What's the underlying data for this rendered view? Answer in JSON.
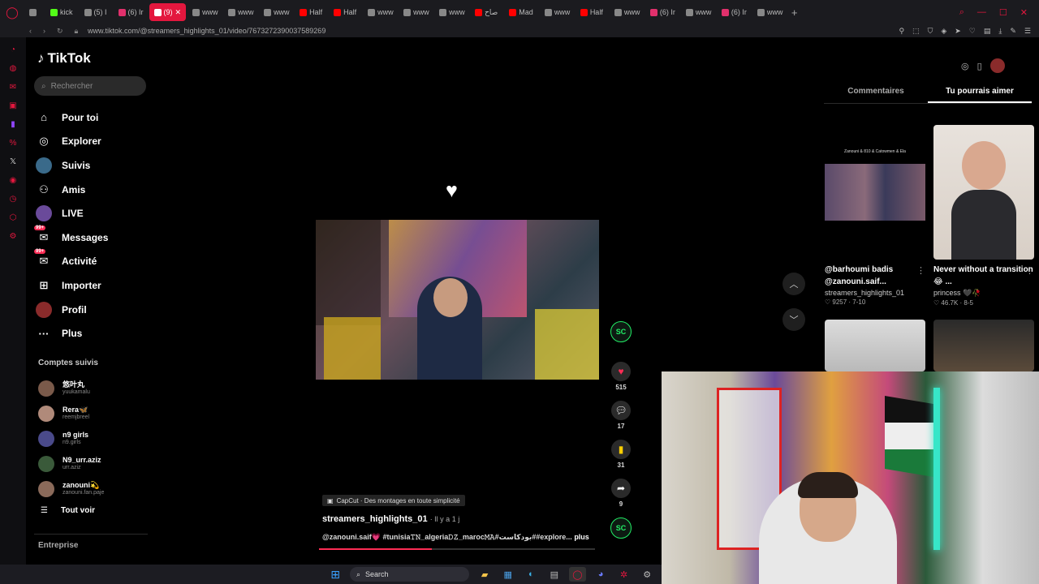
{
  "browser": {
    "tabs": [
      {
        "label": "",
        "color": "#888"
      },
      {
        "label": "kick",
        "color": "#53fc18"
      },
      {
        "label": "(5) I",
        "color": "#888"
      },
      {
        "label": "(6) Ir",
        "color": "#e1306c"
      },
      {
        "label": "(9)",
        "color": "#ffffff",
        "active": true
      },
      {
        "label": "www",
        "color": "#888"
      },
      {
        "label": "www",
        "color": "#888"
      },
      {
        "label": "www",
        "color": "#888"
      },
      {
        "label": "Half",
        "color": "#ff0000"
      },
      {
        "label": "Half",
        "color": "#ff0000"
      },
      {
        "label": "www",
        "color": "#888"
      },
      {
        "label": "www",
        "color": "#888"
      },
      {
        "label": "www",
        "color": "#888"
      },
      {
        "label": "صاح",
        "color": "#ff0000"
      },
      {
        "label": "Mad",
        "color": "#ff0000"
      },
      {
        "label": "www",
        "color": "#888"
      },
      {
        "label": "Half",
        "color": "#ff0000"
      },
      {
        "label": "www",
        "color": "#888"
      },
      {
        "label": "(6) Ir",
        "color": "#e1306c"
      },
      {
        "label": "www",
        "color": "#888"
      },
      {
        "label": "(6) Ir",
        "color": "#e1306c"
      },
      {
        "label": "www",
        "color": "#888"
      }
    ],
    "url": "www.tiktok.com/@streamers_highlights_01/video/7673272390037589269",
    "accent": "#e3173e"
  },
  "tiktok": {
    "logo_text": "TikTok",
    "search_placeholder": "Rechercher",
    "nav": [
      {
        "label": "Pour toi",
        "icon": "home-icon"
      },
      {
        "label": "Explorer",
        "icon": "compass-icon"
      },
      {
        "label": "Suivis",
        "icon": "following-avatar"
      },
      {
        "label": "Amis",
        "icon": "friends-icon"
      },
      {
        "label": "LIVE",
        "icon": "live-avatar"
      },
      {
        "label": "Messages",
        "icon": "message-icon",
        "badge": "99+"
      },
      {
        "label": "Activité",
        "icon": "activity-icon",
        "badge": "99+"
      },
      {
        "label": "Importer",
        "icon": "upload-icon"
      },
      {
        "label": "Profil",
        "icon": "profile-avatar"
      },
      {
        "label": "Plus",
        "icon": "more-icon"
      }
    ],
    "following_title": "Comptes suivis",
    "following": [
      {
        "name": "悠叶丸",
        "handle": "yuukamalu",
        "color": "#7a5a4a"
      },
      {
        "name": "Rera🦋",
        "handle": "reemjbreel",
        "color": "#b08a7a"
      },
      {
        "name": "n9 girls",
        "handle": "n9.girls",
        "color": "#4a4a8a"
      },
      {
        "name": "N9_urr.aziz",
        "handle": "urr.aziz",
        "color": "#3a5a3a"
      },
      {
        "name": "zanouni💫",
        "handle": "zanouni.fan.paje",
        "color": "#8a6a5a"
      }
    ],
    "see_all": "Tout voir",
    "entreprise": "Entreprise"
  },
  "video": {
    "author": "streamers_highlights_01",
    "time": "· Il y a 1 j",
    "description": "@zanouni.saif💗 #tunisia𝚃𝙽_algeria𝙳𝚉_maroc𝙼𝙰#بودكاست##explore...",
    "more": "plus",
    "capcut": "CapCut · Des montages en toute simplicité",
    "creator_initials": "SC",
    "likes": "515",
    "comments": "17",
    "saves": "31",
    "shares": "9",
    "progress": 0.41
  },
  "right_panel": {
    "tabs": [
      "Commentaires",
      "Tu pourrais aimer"
    ],
    "active_tab": 1,
    "cards": [
      {
        "title": "@barhoumi badis @zanouni.saif...",
        "author": "streamers_highlights_01",
        "stats": "♡ 9257 · 7-10",
        "caption": "Zanouni & 810 & Catowmen & Ela"
      },
      {
        "title": "Never without a transition 😂 ...",
        "author": "princess 🖤🥀",
        "stats": "♡ 46.7K · 8-5",
        "caption": ""
      }
    ]
  },
  "taskbar": {
    "search_label": "Search"
  }
}
